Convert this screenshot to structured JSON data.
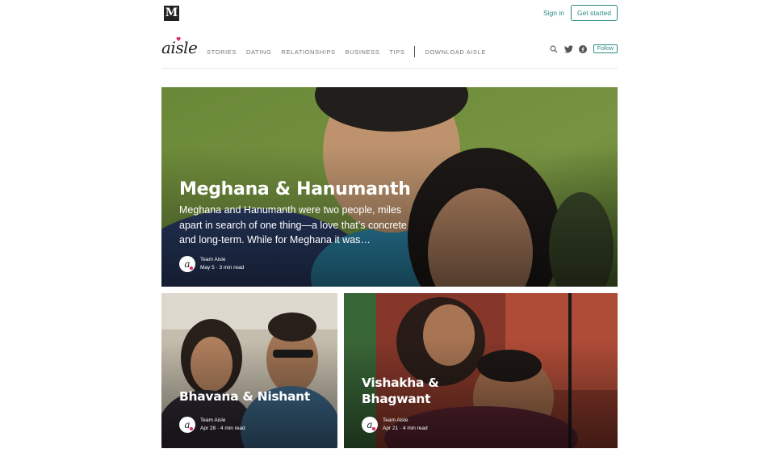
{
  "topbar": {
    "logo": "M",
    "signin": "Sign in",
    "get_started": "Get started"
  },
  "nav": {
    "logo": "aisle",
    "links": [
      "STORIES",
      "DATING",
      "RELATIONSHIPS",
      "BUSINESS",
      "TIPS"
    ],
    "download": "DOWNLOAD AISLE",
    "follow": "Follow",
    "icons": [
      "search-icon",
      "twitter-icon",
      "facebook-icon"
    ]
  },
  "colors": {
    "accent": "#2b8a84",
    "brand": "#e0245e"
  },
  "featured": {
    "title": "Meghana & Hanumanth",
    "subtitle": "Meghana and Hanumanth were two people, miles apart in search of one thing—a love that’s concrete and long-term. While for Meghana it was…",
    "author": "Team Aisle",
    "meta": "May 5 · 3 min read"
  },
  "stories": [
    {
      "title": "Bhavana & Nishant",
      "author": "Team Aisle",
      "meta": "Apr 28 · 4 min read"
    },
    {
      "title": "Vishakha & Bhagwant",
      "author": "Team Aisle",
      "meta": "Apr 21 · 4 min read"
    }
  ]
}
